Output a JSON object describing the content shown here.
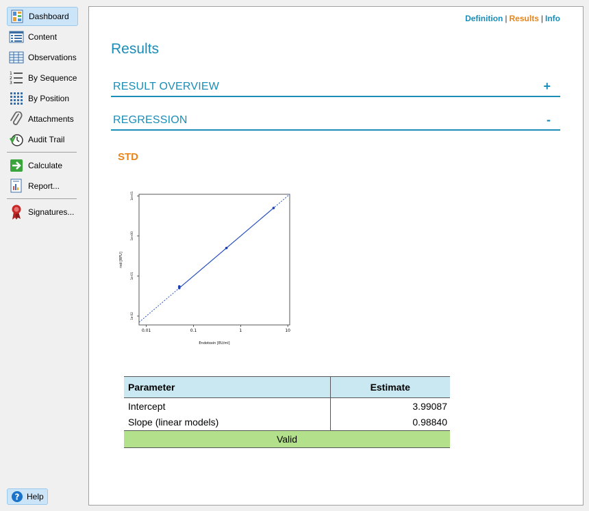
{
  "sidebar": {
    "items": [
      {
        "label": "Dashboard",
        "icon": "dashboard-icon"
      },
      {
        "label": "Content",
        "icon": "content-icon"
      },
      {
        "label": "Observations",
        "icon": "observations-icon"
      },
      {
        "label": "By Sequence",
        "icon": "sequence-icon"
      },
      {
        "label": "By Position",
        "icon": "position-icon"
      },
      {
        "label": "Attachments",
        "icon": "paperclip-icon"
      },
      {
        "label": "Audit Trail",
        "icon": "audit-clock-icon"
      },
      {
        "label": "Calculate",
        "icon": "arrow-right-icon"
      },
      {
        "label": "Report...",
        "icon": "report-icon"
      },
      {
        "label": "Signatures...",
        "icon": "seal-icon"
      }
    ],
    "help_label": "Help"
  },
  "top_links": {
    "definition": "Definition",
    "results": "Results",
    "info": "Info",
    "separator": "|"
  },
  "page_title": "Results",
  "sections": {
    "overview": {
      "label": "RESULT OVERVIEW",
      "toggle": "+"
    },
    "regression": {
      "label": "REGRESSION",
      "toggle": "-"
    }
  },
  "std_label": "STD",
  "colors": {
    "accent_blue": "#1a8db8",
    "accent_orange": "#e8841a",
    "valid_green": "#b3e08a",
    "header_blue": "#c9e8f2"
  },
  "chart_data": {
    "type": "scatter",
    "xlabel": "Endotoxin [EU/ml]",
    "ylabel": "rxd [RFU]",
    "x_scale": "log",
    "y_scale": "log",
    "xlim": [
      0.007,
      11
    ],
    "ylim": [
      0.006,
      11
    ],
    "x_ticks": [
      "0.01",
      "0.1",
      "1",
      "10"
    ],
    "y_ticks": [
      "1e-02",
      "1e-01",
      "1e+00",
      "1e+01"
    ],
    "points": [
      {
        "x": 0.05,
        "y": 0.05
      },
      {
        "x": 0.05,
        "y": 0.055
      },
      {
        "x": 0.5,
        "y": 0.5
      },
      {
        "x": 5,
        "y": 5
      }
    ],
    "fit_line": {
      "x": [
        0.05,
        5
      ],
      "y": [
        0.05,
        5
      ]
    },
    "extrapolated_line": {
      "x": [
        0.007,
        11
      ],
      "y": [
        0.007,
        11
      ]
    }
  },
  "table": {
    "headers": [
      "Parameter",
      "Estimate"
    ],
    "rows": [
      {
        "parameter": "Intercept",
        "estimate": "3.99087"
      },
      {
        "parameter": "Slope (linear models)",
        "estimate": "0.98840"
      }
    ],
    "status": "Valid"
  }
}
